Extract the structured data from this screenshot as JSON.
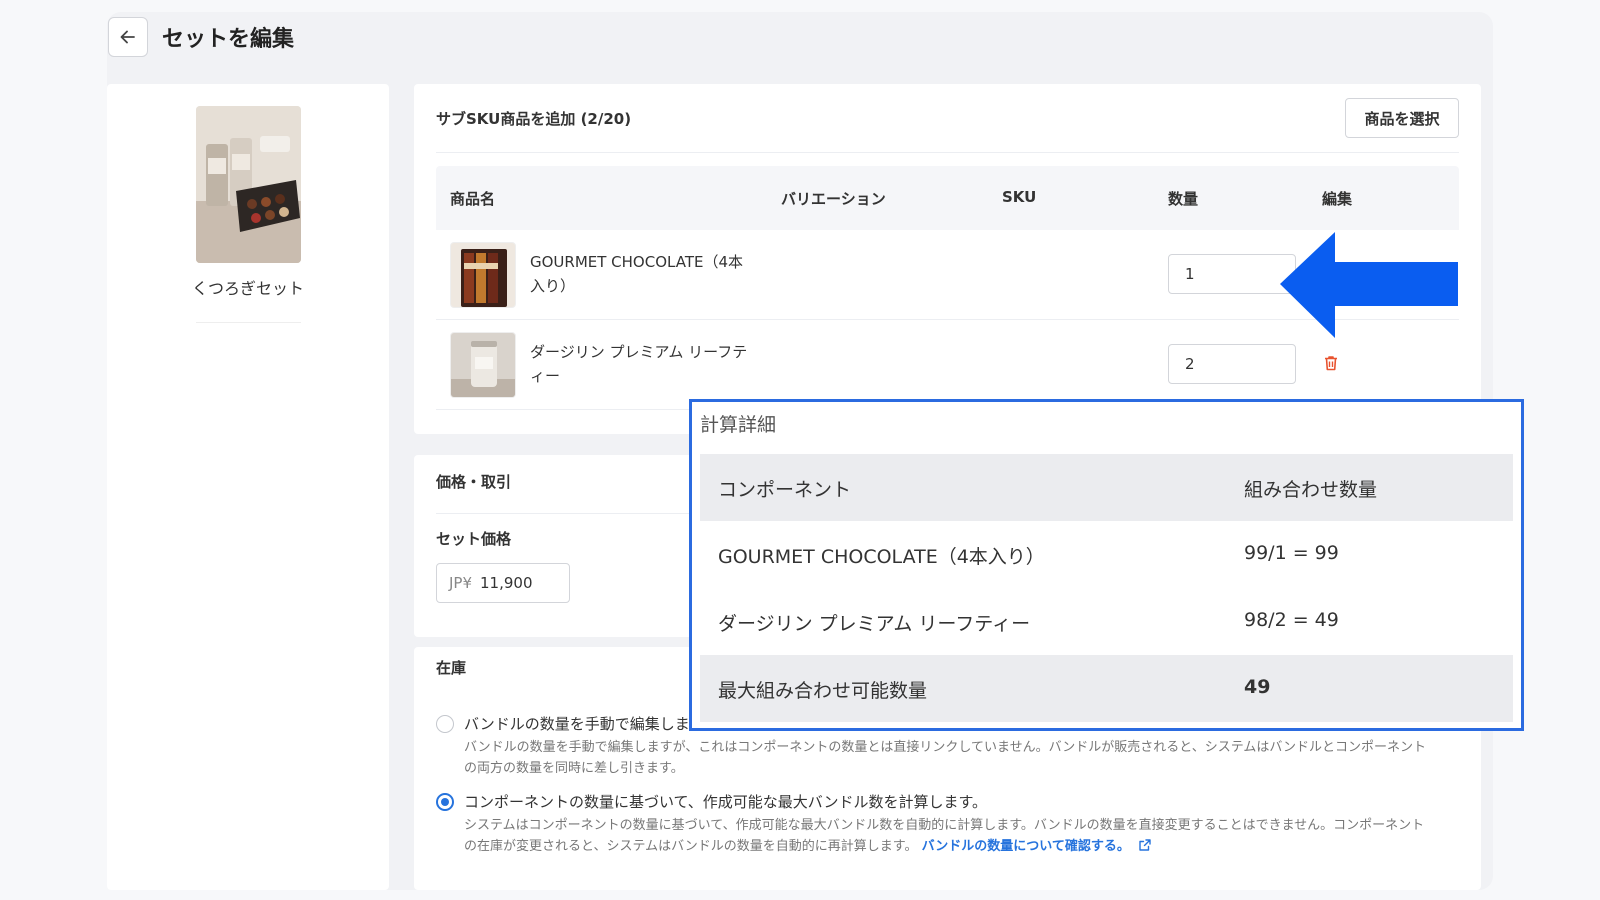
{
  "header": {
    "title": "セットを編集",
    "back_icon": "arrow-left-icon"
  },
  "left": {
    "product_name": "くつろぎセット"
  },
  "sub_sku": {
    "title": "サブSKU商品を追加 (2/20)",
    "select_button": "商品を選択",
    "columns": [
      "商品名",
      "バリエーション",
      "SKU",
      "数量",
      "編集"
    ],
    "rows": [
      {
        "name": "GOURMET CHOCOLATE（4本入り）",
        "name_line1": "GOURMET CHOCOLATE（4本",
        "name_line2": "入り）",
        "variation": "",
        "sku": "",
        "quantity": "1"
      },
      {
        "name": "ダージリン プレミアム リーフティー",
        "name_line1": "ダージリン プレミアム リーフテ",
        "name_line2": "ィー",
        "variation": "",
        "sku": "",
        "quantity": "2"
      }
    ]
  },
  "price": {
    "section_title": "価格・取引",
    "set_price_label": "セット価格",
    "currency": "JP¥",
    "value": "11,900"
  },
  "stock": {
    "title": "在庫",
    "options": [
      {
        "label": "バンドルの数量を手動で編集します。",
        "desc_line1": "バンドルの数量を手動で編集しますが、これはコンポーネントの数量とは直接リンクしていません。バンドルが販売されると、システムはバンドルとコンポーネント",
        "desc_line2": "の両方の数量を同時に差し引きます。",
        "selected": false
      },
      {
        "label": "コンポーネントの数量に基づいて、作成可能な最大バンドル数を計算します。",
        "desc_line1": "システムはコンポーネントの数量に基づいて、作成可能な最大バンドル数を自動的に計算します。バンドルの数量を直接変更することはできません。コンポーネント",
        "desc_line2": "の在庫が変更されると、システムはバンドルの数量を自動的に再計算します。",
        "link": "バンドルの数量について確認する。",
        "selected": true
      }
    ]
  },
  "calc": {
    "title": "計算詳細",
    "header": {
      "component": "コンポーネント",
      "count": "組み合わせ数量"
    },
    "rows": [
      {
        "component": "GOURMET CHOCOLATE（4本入り）",
        "count": "99/1 = 99"
      },
      {
        "component": "ダージリン プレミアム リーフティー",
        "count": "98/2 = 49"
      }
    ],
    "total": {
      "label": "最大組み合わせ可能数量",
      "value": "49"
    }
  },
  "colors": {
    "accent": "#2673dd",
    "arrow": "#0a5df0",
    "highlight_border": "#2b6be0",
    "delete": "#e8532f"
  }
}
